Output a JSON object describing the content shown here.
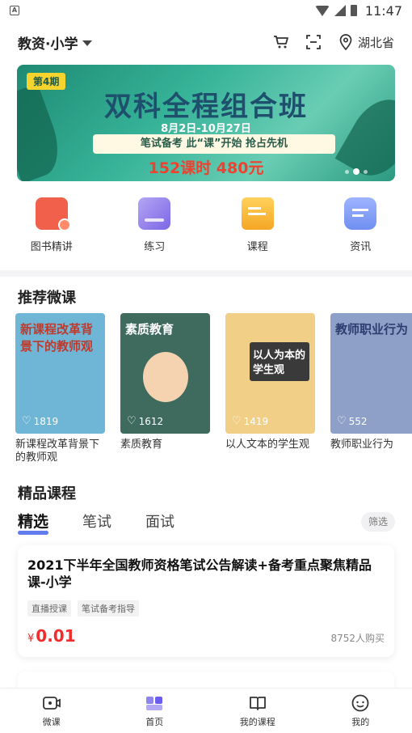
{
  "status_bar": {
    "time": "11:47",
    "app_badge": "A"
  },
  "header": {
    "exam_type": "教资·小学",
    "location": "湖北省"
  },
  "banner": {
    "issue": "第4期",
    "title": "双科全程组合班",
    "date_range": "8月2日-10月27日",
    "slogan": "笔试备考 此“课”开始 抢占先机",
    "price_text": "152课时 480元",
    "accent": "#36b398"
  },
  "quick_entries": [
    {
      "label": "图书精讲",
      "icon": "book-icon",
      "color": "#f0604a"
    },
    {
      "label": "练习",
      "icon": "practice-icon",
      "color": "#8a74e8"
    },
    {
      "label": "课程",
      "icon": "course-icon",
      "color": "#f5b323"
    },
    {
      "label": "资讯",
      "icon": "news-icon",
      "color": "#6f8ff0"
    }
  ],
  "recommended": {
    "title": "推荐微课",
    "items": [
      {
        "title": "新课程改革背景下的教师观",
        "thumb_text": "新课程改革背景下的教师观",
        "likes": "1819",
        "bg": "#6fb6d6"
      },
      {
        "title": "素质教育",
        "thumb_text": "素质教育",
        "likes": "1612",
        "bg": "#3e6b5e"
      },
      {
        "title": "以人文本的学生观",
        "thumb_text": "以人为本的学生观",
        "likes": "1419",
        "bg": "#f2cf86"
      },
      {
        "title": "教师职业行为",
        "thumb_text": "教师职业行为",
        "likes": "552",
        "bg": "#8fa0c8"
      }
    ]
  },
  "premium": {
    "title": "精品课程",
    "tabs": [
      "精选",
      "笔试",
      "面试"
    ],
    "filter_label": "筛选",
    "course": {
      "title": "2021下半年全国教师资格笔试公告解读+备考重点聚焦精品课-小学",
      "tags": [
        "直播授课",
        "笔试备考指导"
      ],
      "currency": "¥",
      "price": "0.01",
      "buyers": "8752人购买"
    }
  },
  "bottom_nav": [
    {
      "label": "微课",
      "icon": "video-icon"
    },
    {
      "label": "首页",
      "icon": "home-icon",
      "active_color": "#6a5df0"
    },
    {
      "label": "我的课程",
      "icon": "my-course-icon"
    },
    {
      "label": "我的",
      "icon": "profile-icon"
    }
  ]
}
